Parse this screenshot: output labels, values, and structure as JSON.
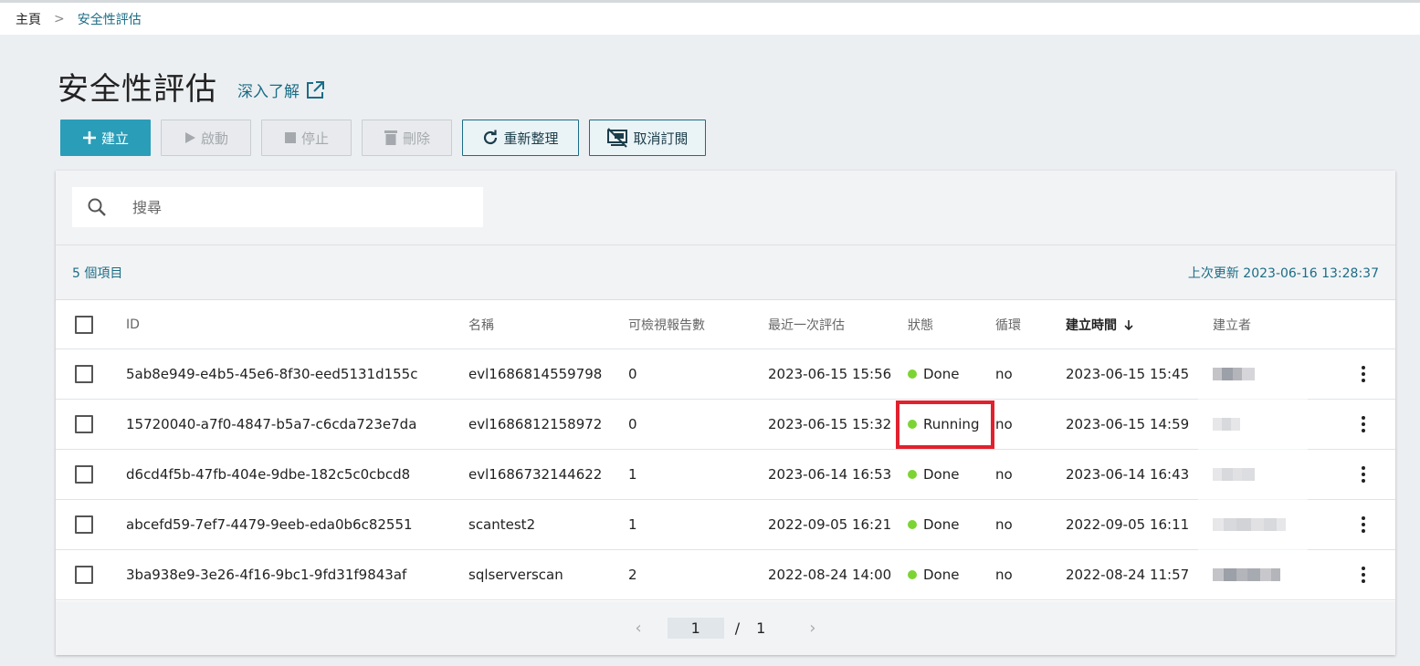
{
  "breadcrumb": {
    "home": "主頁",
    "separator": ">",
    "current": "安全性評估"
  },
  "page": {
    "title": "安全性評估",
    "learn_more": "深入了解"
  },
  "toolbar": {
    "create": "建立",
    "start": "啟動",
    "stop": "停止",
    "delete": "刪除",
    "refresh": "重新整理",
    "unsubscribe": "取消訂閱"
  },
  "search": {
    "placeholder": "搜尋"
  },
  "summary": {
    "count_label": "5 個項目",
    "last_updated": "上次更新 2023-06-16 13:28:37"
  },
  "table": {
    "headers": {
      "id": "ID",
      "name": "名稱",
      "reports": "可檢視報告數",
      "last_eval": "最近一次評估",
      "status": "狀態",
      "cycle": "循環",
      "created": "建立時間",
      "creator": "建立者"
    },
    "rows": [
      {
        "id": "5ab8e949-e4b5-45e6-8f30-eed5131d155c",
        "name": "evl1686814559798",
        "reports": "0",
        "last_eval": "2023-06-15 15:56",
        "status": "Done",
        "cycle": "no",
        "created": "2023-06-15 15:45"
      },
      {
        "id": "15720040-a7f0-4847-b5a7-c6cda723e7da",
        "name": "evl1686812158972",
        "reports": "0",
        "last_eval": "2023-06-15 15:32",
        "status": "Running",
        "cycle": "no",
        "created": "2023-06-15 14:59"
      },
      {
        "id": "d6cd4f5b-47fb-404e-9dbe-182c5c0cbcd8",
        "name": "evl1686732144622",
        "reports": "1",
        "last_eval": "2023-06-14 16:53",
        "status": "Done",
        "cycle": "no",
        "created": "2023-06-14 16:43"
      },
      {
        "id": "abcefd59-7ef7-4479-9eeb-eda0b6c82551",
        "name": "scantest2",
        "reports": "1",
        "last_eval": "2022-09-05 16:21",
        "status": "Done",
        "cycle": "no",
        "created": "2022-09-05 16:11"
      },
      {
        "id": "3ba938e9-3e26-4f16-9bc1-9fd31f9843af",
        "name": "sqlserverscan",
        "reports": "2",
        "last_eval": "2022-08-24 14:00",
        "status": "Done",
        "cycle": "no",
        "created": "2022-08-24 11:57"
      }
    ]
  },
  "pagination": {
    "current": "1",
    "separator": "/",
    "total": "1"
  },
  "colors": {
    "accent": "#2a9db8",
    "link": "#1b6d85",
    "status_ok": "#7cd433",
    "highlight": "#e1212e"
  },
  "icons": [
    "plus-icon",
    "play-icon",
    "stop-icon",
    "trash-icon",
    "refresh-icon",
    "unsubscribe-icon",
    "external-link-icon",
    "search-icon",
    "sort-down-icon",
    "kebab-menu-icon",
    "chevron-left-icon",
    "chevron-right-icon"
  ]
}
